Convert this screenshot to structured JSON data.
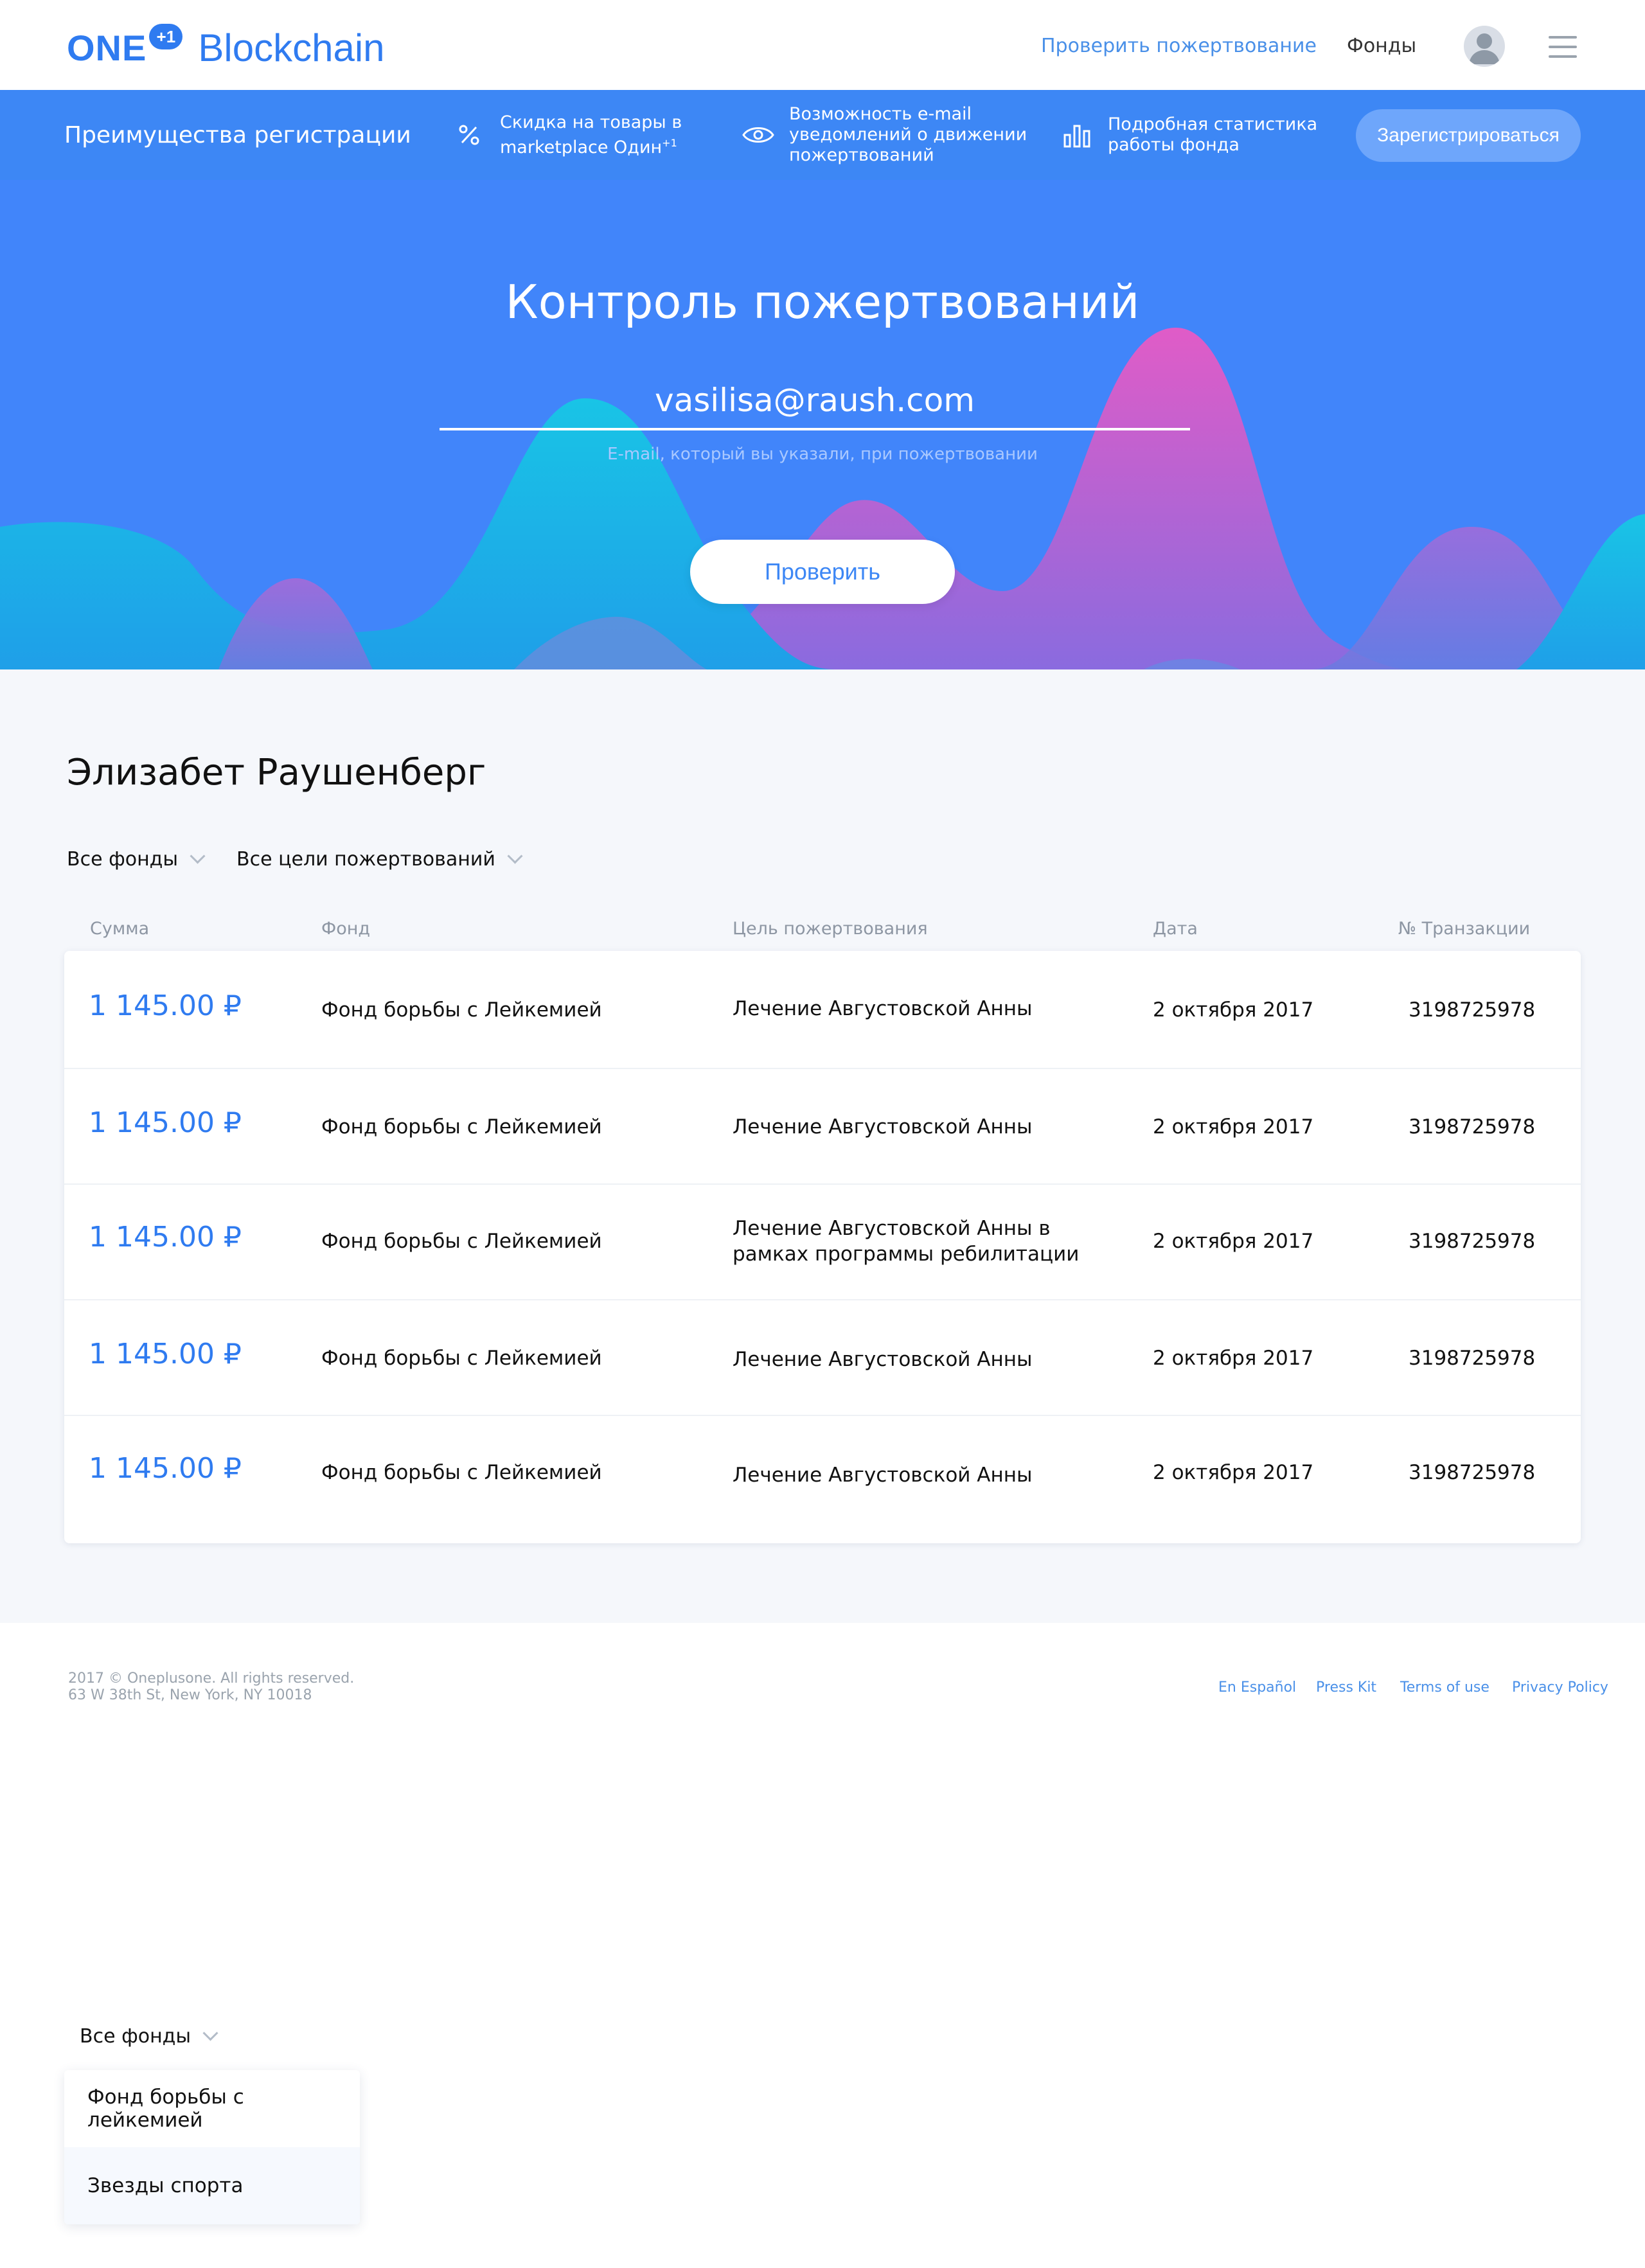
{
  "header": {
    "logo_one": "ONE",
    "logo_plus": "+1",
    "logo_text": "Blockchain",
    "nav_check": "Проверить пожертвование",
    "nav_funds": "Фонды",
    "avatar_icon": "user-avatar",
    "menu_icon": "hamburger-menu-icon"
  },
  "benefits": {
    "title": "Преимущества регистрации",
    "items": [
      {
        "icon": "percent-icon",
        "line1": "Скидка на товары в",
        "line2": "marketplace Один",
        "sup": "+1"
      },
      {
        "icon": "eye-icon",
        "line1": "Возможность e-mail",
        "line2": "уведомлений о движении",
        "line3": "пожертвований"
      },
      {
        "icon": "bar-chart-icon",
        "line1": "Подробная статистика",
        "line2": "работы фонда"
      }
    ],
    "register_label": "Зарегистрироваться"
  },
  "hero": {
    "title": "Контроль пожертвований",
    "email_value": "vasilisa@raush.com",
    "email_hint": "E-mail, который вы указали, при пожертвовании",
    "check_label": "Проверить"
  },
  "main": {
    "person": "Элизабет Раушенберг",
    "filters": [
      "Все фонды",
      "Все цели пожертвований"
    ],
    "columns": [
      "Сумма",
      "Фонд",
      "Цель пожертвования",
      "Дата",
      "№ Транзакции"
    ],
    "rows": [
      {
        "amount": "1 145.00 ₽",
        "fund": "Фонд борьбы с Лейкемией",
        "purpose": "Лечение Августовской Анны",
        "purpose2": "",
        "date": "2 октября 2017",
        "tx": "3198725978"
      },
      {
        "amount": "1 145.00 ₽",
        "fund": "Фонд борьбы с Лейкемией",
        "purpose": "Лечение Августовской Анны",
        "purpose2": "",
        "date": "2 октября 2017",
        "tx": "3198725978"
      },
      {
        "amount": "1 145.00 ₽",
        "fund": "Фонд борьбы с Лейкемией",
        "purpose": "Лечение Августовской Анны в",
        "purpose2": "рамках программы ребилитации",
        "date": "2 октября 2017",
        "tx": "3198725978"
      },
      {
        "amount": "1 145.00 ₽",
        "fund": "Фонд борьбы с Лейкемией",
        "purpose": "Лечение Августовской Анны",
        "purpose2": "",
        "date": "2 октября 2017",
        "tx": "3198725978"
      },
      {
        "amount": "1 145.00 ₽",
        "fund": "Фонд борьбы с Лейкемией",
        "purpose": "Лечение Августовской Анны",
        "purpose2": "",
        "date": "2 октября 2017",
        "tx": "3198725978"
      }
    ]
  },
  "footer": {
    "copyright": "2017 © Oneplusone. All rights reserved.",
    "address": "63 W 38th St, New York, NY 10018",
    "links": [
      "En Español",
      "Press Kit",
      "Terms of use",
      "Privacy Policy"
    ]
  },
  "dropdown_demo": {
    "label": "Все фонды",
    "options": [
      "Фонд борьбы с лейкемией",
      "Звезды спорта"
    ]
  },
  "colors": {
    "accent": "#2f7bf0",
    "benefits_bar": "#3d87f5",
    "hero_bg": "#4185fa",
    "page_bg": "#f5f7fb"
  }
}
